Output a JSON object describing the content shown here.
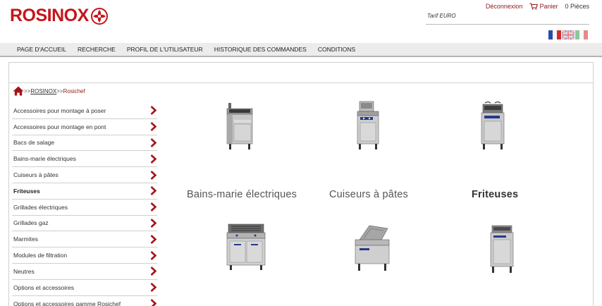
{
  "header": {
    "brand": "ROSINOX",
    "logout": "Déconnexion",
    "cart": "Panier",
    "cart_count": "0 Pièces",
    "tarif": "Tarif EURO",
    "colors": {
      "brand_red": "#c4161c",
      "link_red": "#8b1a1a"
    }
  },
  "languages": [
    {
      "code": "fr",
      "icon": "flag-fr-icon"
    },
    {
      "code": "en",
      "icon": "flag-uk-icon"
    },
    {
      "code": "it",
      "icon": "flag-it-icon"
    }
  ],
  "nav": {
    "items": [
      "PAGE D'ACCUEIL",
      "RECHERCHE",
      "PROFIL DE L'UTILISATEUR",
      "HISTORIQUE DES COMMANDES",
      "CONDITIONS"
    ]
  },
  "breadcrumb": {
    "sep1": ">>",
    "link": "ROSINOX",
    "sep2": ">>",
    "current": "Rosichef"
  },
  "sidebar": {
    "items": [
      {
        "label": "Accessoires pour montage à poser",
        "active": false
      },
      {
        "label": "Accessoires pour montage en pont",
        "active": false
      },
      {
        "label": "Bacs de salage",
        "active": false
      },
      {
        "label": "Bains-marie électriques",
        "active": false
      },
      {
        "label": "Cuiseurs à pâtes",
        "active": false
      },
      {
        "label": "Friteuses",
        "active": true
      },
      {
        "label": "Grillades électriques",
        "active": false
      },
      {
        "label": "Grillades gaz",
        "active": false
      },
      {
        "label": "Marmites",
        "active": false
      },
      {
        "label": "Modules de filtration",
        "active": false
      },
      {
        "label": "Neutres",
        "active": false
      },
      {
        "label": "Options et accessoires",
        "active": false
      },
      {
        "label": "Options et accessoires gamme Rosichef",
        "active": false
      }
    ]
  },
  "products": [
    {
      "label": "Bains-marie électriques",
      "bold": false,
      "icon": "bain-marie-icon"
    },
    {
      "label": "Cuiseurs à pâtes",
      "bold": false,
      "icon": "pasta-cooker-icon"
    },
    {
      "label": "Friteuses",
      "bold": true,
      "icon": "fryer-icon"
    },
    {
      "label": "",
      "icon": "grill-icon"
    },
    {
      "label": "",
      "icon": "braising-pan-icon"
    },
    {
      "label": "",
      "icon": "cabinet-icon"
    }
  ]
}
